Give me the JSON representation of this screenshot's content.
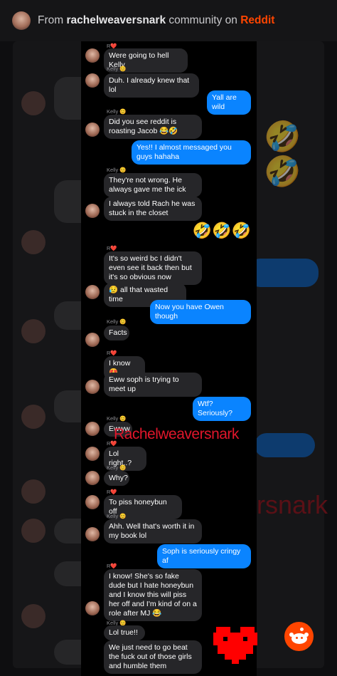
{
  "header": {
    "prefix": "From ",
    "community": "rachelweaversnark",
    "middle": " community on ",
    "brand": "Reddit"
  },
  "senders": {
    "r": "R❤️",
    "k": "Kelly 😊"
  },
  "messages": [
    {
      "text": "Were going to hell Kelly"
    },
    {
      "text": "Duh. I already knew that lol"
    },
    {
      "text": "Yall are wild"
    },
    {
      "text": "Did you see reddit is roasting Jacob 😂🤣"
    },
    {
      "text": "Yes!! I almost messaged you guys hahaha"
    },
    {
      "text": "They're not wrong. He always gave me the ick"
    },
    {
      "text": "I always told Rach he was stuck in the closet"
    },
    {
      "text": "🤣🤣🤣"
    },
    {
      "text": "It's so weird bc I didn't even see it back then but it's so obvious now"
    },
    {
      "text": "😥 all that wasted time"
    },
    {
      "text": "Now you have Owen though"
    },
    {
      "text": "Facts"
    },
    {
      "text": "I know 😍"
    },
    {
      "text": "Eww soph is trying to meet up"
    },
    {
      "text": "Wtf? Seriously?"
    },
    {
      "text": "Ewww"
    },
    {
      "text": "Lol right..?"
    },
    {
      "text": "Why?"
    },
    {
      "text": "To piss honeybun off"
    },
    {
      "text": "Ahh. Well that's worth it in my book lol"
    },
    {
      "text": "Soph is seriously cringy af"
    },
    {
      "text": "I know! She's so fake dude but I hate honeybun and I know this will piss her off and I'm kind of on a role after MJ 😂"
    },
    {
      "text": "Lol true!!"
    },
    {
      "text": "We just need to go beat the fuck out of those girls and humble them"
    }
  ],
  "watermark": "Rachelweaversnark",
  "watermark_bg": "rsnark",
  "colors": {
    "incoming": "#262629",
    "outgoing": "#0a84ff",
    "brand": "#ff4500",
    "watermark": "#e0162b"
  },
  "icons": {
    "fab": "reddit-alien-icon",
    "overlay": "red-pixel-heart-icon"
  }
}
